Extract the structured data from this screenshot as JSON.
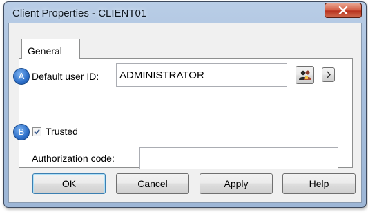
{
  "window": {
    "title": "Client Properties - CLIENT01",
    "close_icon": "close-icon"
  },
  "tabs": [
    {
      "label": "General",
      "selected": true
    }
  ],
  "badges": {
    "a": "A",
    "b": "B"
  },
  "default_user": {
    "label": "Default user ID:",
    "value": "ADMINISTRATOR",
    "browse_icon": "users-icon",
    "more_icon": "chevron-right-icon"
  },
  "trusted": {
    "label": "Trusted",
    "checked": true
  },
  "authorization": {
    "label": "Authorization code:",
    "value": ""
  },
  "buttons": {
    "ok": "OK",
    "cancel": "Cancel",
    "apply": "Apply",
    "help": "Help"
  },
  "colors": {
    "accent": "#2d6fc9",
    "close": "#c8432b",
    "titlebar": "#a8c0de"
  }
}
